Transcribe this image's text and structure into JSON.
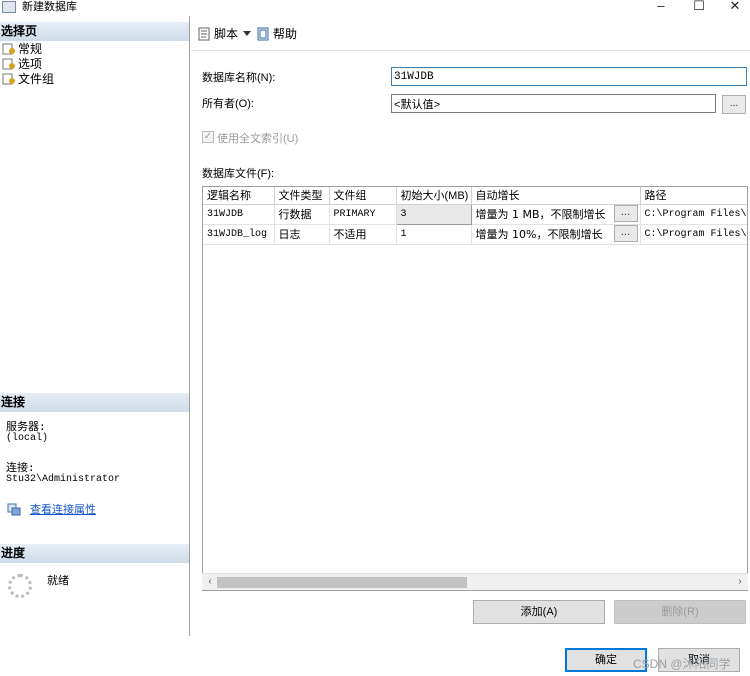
{
  "window": {
    "title": "新建数据库",
    "minimize": "–",
    "maximize": "☐",
    "close": "✕"
  },
  "left_panel": {
    "select_page_header": "选择页",
    "pages": [
      "常规",
      "选项",
      "文件组"
    ],
    "connection_header": "连接",
    "server_label": "服务器:",
    "server_value": "(local)",
    "connection_label": "连接:",
    "connection_value": "Stu32\\Administrator",
    "view_props_link": "查看连接属性",
    "progress_header": "进度",
    "progress_status": "就绪"
  },
  "toolbar": {
    "script_label": "脚本",
    "help_label": "帮助"
  },
  "form": {
    "db_name_label": "数据库名称(N):",
    "db_name_value": "31WJDB",
    "owner_label": "所有者(O):",
    "owner_value": "<默认值>",
    "owner_browse": "...",
    "fulltext_label": "使用全文索引(U)",
    "fulltext_checked": true,
    "files_label": "数据库文件(F):"
  },
  "files_table": {
    "columns": [
      "逻辑名称",
      "文件类型",
      "文件组",
      "初始大小(MB)",
      "自动增长",
      "路径"
    ],
    "rows": [
      {
        "name": "31WJDB",
        "type": "行数据",
        "filegroup": "PRIMARY",
        "size": "3",
        "growth": "增量为 1 MB，不限制增长",
        "browse": "...",
        "path": "C:\\Program Files\\Microsoft"
      },
      {
        "name": "31WJDB_log",
        "type": "日志",
        "filegroup": "不适用",
        "size": "1",
        "growth": "增量为 10%，不限制增长",
        "browse": "...",
        "path": "C:\\Program Files\\Microsoft"
      }
    ],
    "scroll_left": "‹",
    "scroll_right": "›"
  },
  "buttons": {
    "add": "添加(A)",
    "remove": "删除(R)",
    "ok": "确定",
    "cancel": "取消"
  },
  "watermark": "CSDN @沐阳同学"
}
